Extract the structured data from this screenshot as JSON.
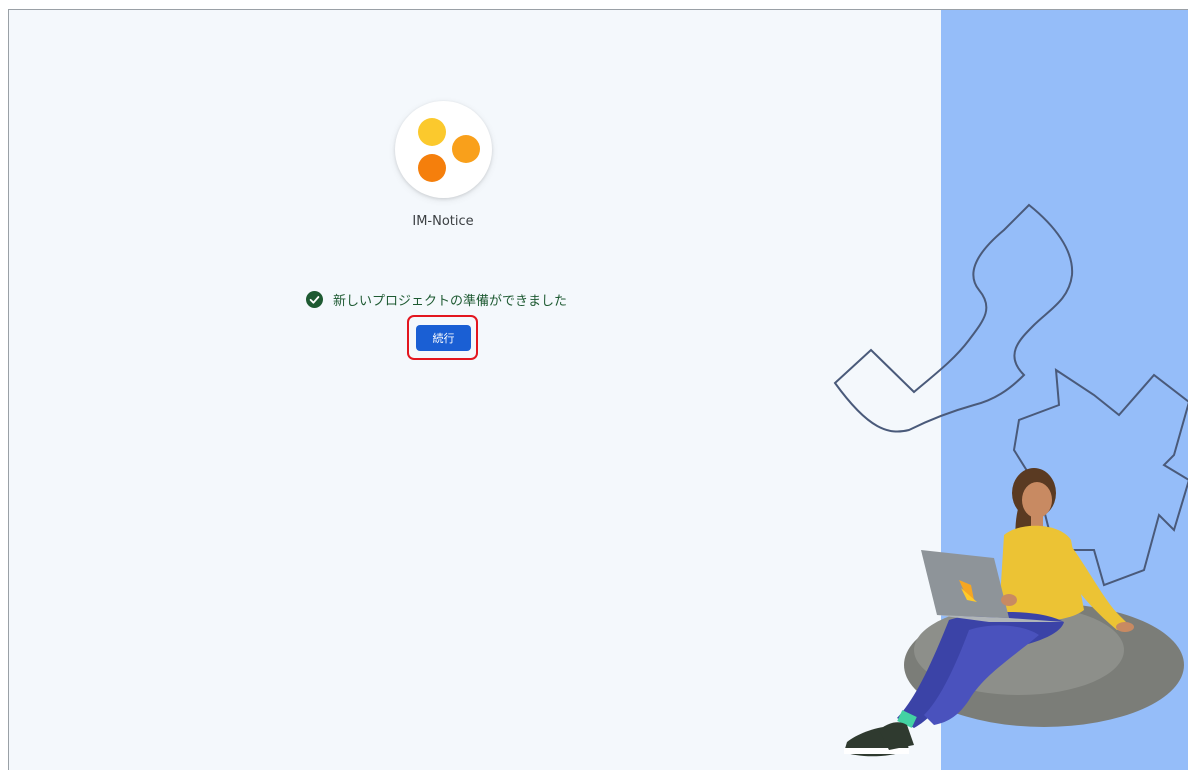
{
  "project": {
    "name": "IM-Notice",
    "logo_colors": [
      "#fbc02d",
      "#f9a825",
      "#f57c00"
    ]
  },
  "status": {
    "icon": "check-circle-icon",
    "message": "新しいプロジェクトの準備ができました",
    "color": "#1e5a32"
  },
  "actions": {
    "continue_label": "続行"
  },
  "colors": {
    "background": "#f4f8fc",
    "accent_panel": "#95bdf9",
    "button": "#1a5fd4",
    "highlight_border": "#e3161f"
  }
}
